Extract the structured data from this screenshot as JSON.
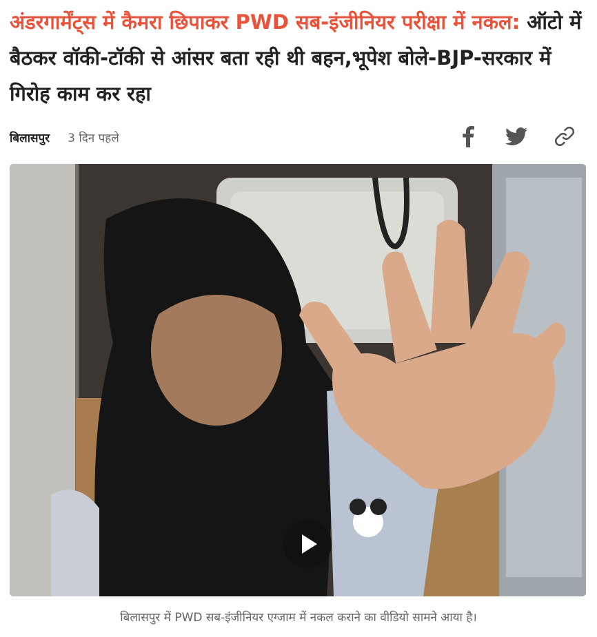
{
  "headline": {
    "accent": "अंडरगार्मेंट्स में कैमरा छिपाकर PWD सब-इंजीनियर परीक्षा में नकल:",
    "text": " ऑटो में बैठकर वॉकी-टॉकी से आंसर बता रही थी बहन,भूपेश बोले-BJP-सरकार में गिरोह काम कर रहा"
  },
  "meta": {
    "location": "बिलासपुर",
    "time": "3 दिन पहले"
  },
  "share": {
    "icons": [
      "facebook-icon",
      "twitter-icon",
      "link-icon"
    ]
  },
  "colors": {
    "accent": "#e8533b",
    "text": "#222222",
    "muted": "#666666"
  },
  "video": {
    "play_icon": "play-icon"
  },
  "caption": "बिलासपुर में PWD सब-इंजीनियर एग्जाम में नकल कराने का वीडियो सामने आया है।"
}
